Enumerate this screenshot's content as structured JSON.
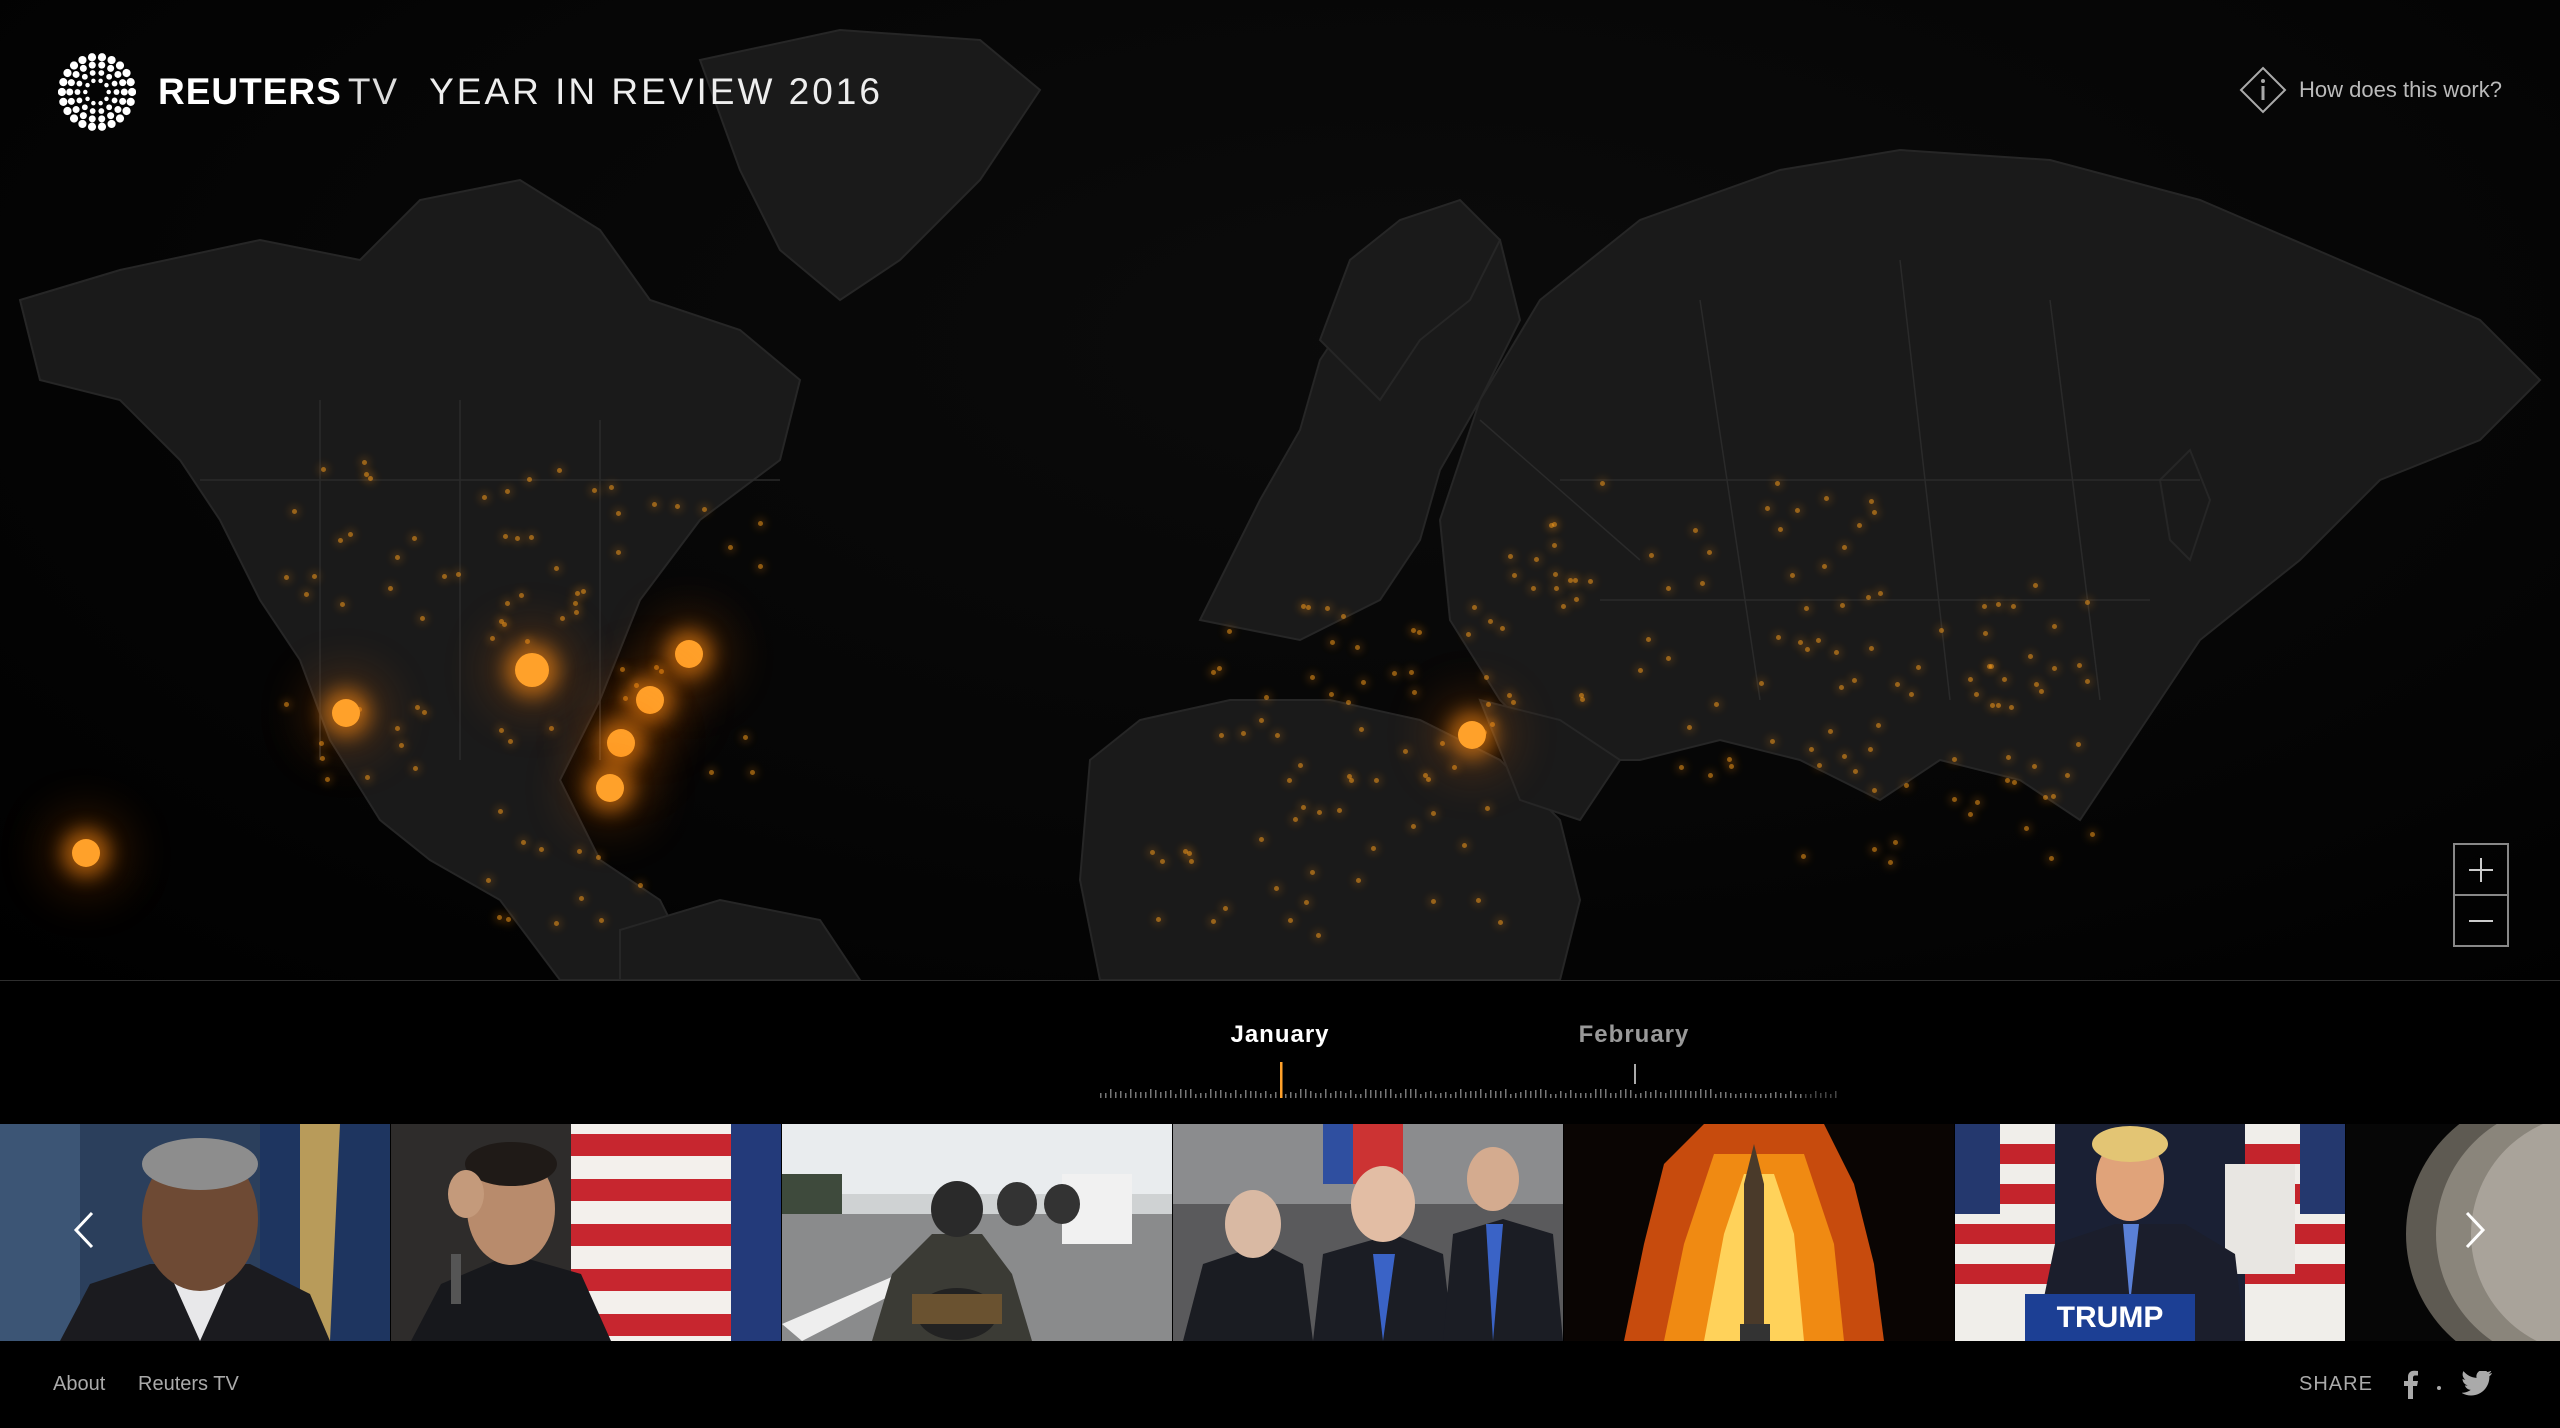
{
  "header": {
    "brand": "REUTERS",
    "brand_suffix": "TV",
    "title": "YEAR IN REVIEW 2016",
    "help_label": "How does this work?"
  },
  "timeline": {
    "months": [
      "January",
      "February"
    ],
    "active_month": "January"
  },
  "thumbnails": [
    {
      "subject": "man portrait",
      "flag": "american-flag"
    },
    {
      "subject": "man with microphone",
      "flag": "american-flag"
    },
    {
      "subject": "motorcycle police convoy",
      "flag": ""
    },
    {
      "subject": "group of men in suits",
      "flag": ""
    },
    {
      "subject": "rocket launch fire",
      "flag": ""
    },
    {
      "subject": "man at podium",
      "podium_text": "TRUMP"
    },
    {
      "subject": "partial planet",
      "flag": ""
    }
  ],
  "footer": {
    "about": "About",
    "reuters_tv": "Reuters TV",
    "share": "SHARE"
  },
  "colors": {
    "accent": "#ffa12a",
    "background": "#000000",
    "land": "#1a1a1a"
  },
  "icons": {
    "logo": "reuters-logo-icon",
    "help": "info-diamond-icon",
    "zoom_in": "plus-icon",
    "zoom_out": "minus-icon",
    "prev": "chevron-left-icon",
    "next": "chevron-right-icon",
    "facebook": "facebook-icon",
    "twitter": "twitter-icon"
  }
}
